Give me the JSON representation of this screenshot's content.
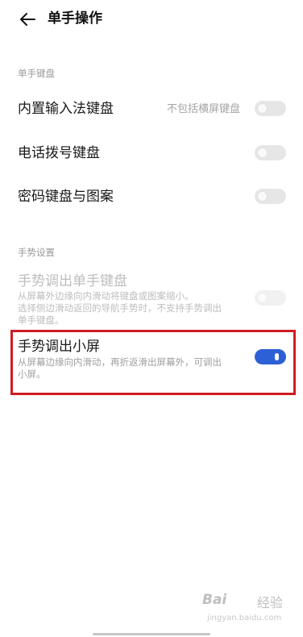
{
  "header": {
    "title": "单手操作"
  },
  "sections": {
    "keyboard": {
      "title": "单手键盘",
      "items": [
        {
          "label": "内置输入法键盘",
          "hint": "不包括横屏键盘",
          "enabled": false
        },
        {
          "label": "电话拨号键盘",
          "enabled": false
        },
        {
          "label": "密码键盘与图案",
          "enabled": false
        }
      ]
    },
    "gesture": {
      "title": "手势设置",
      "items": [
        {
          "label": "手势调出单手键盘",
          "desc_lines": [
            "从屏幕外边缘向内滑动将键盘或图案缩小。",
            "选择侧边滑动返回的导航手势时，不支持手势调出",
            "单手键盘。"
          ],
          "enabled": false,
          "disabled": true
        },
        {
          "label": "手势调出小屏",
          "desc_lines": [
            "从屏幕边缘向内滑动，再折返滑出屏幕外，可调出",
            "小屏。"
          ],
          "enabled": true,
          "highlighted": true
        }
      ]
    }
  },
  "watermark": {
    "logo": "Bai",
    "logo_suffix": "经验",
    "sub": "jingyan.baidu.com"
  },
  "colors": {
    "accent": "#2d5fd7",
    "highlight_border": "#d01c22"
  }
}
